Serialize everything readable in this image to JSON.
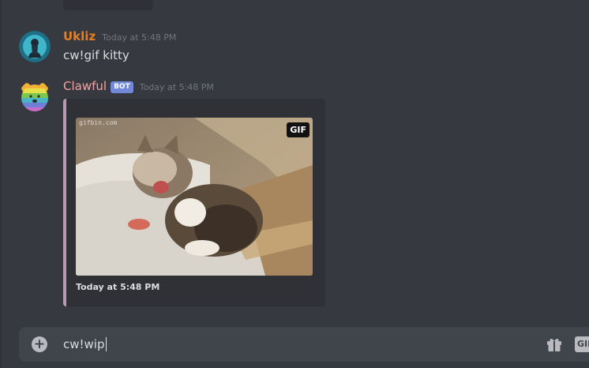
{
  "messages": [
    {
      "username": "Ukliz",
      "timestamp": "Today at 5:48 PM",
      "content": "cw!gif kitty",
      "avatar_icon": "user-avatar"
    },
    {
      "username": "Clawful",
      "bot_tag": "BOT",
      "timestamp": "Today at 5:48 PM",
      "avatar_icon": "rainbow-bear-avatar",
      "embed": {
        "accent_color": "#b89bb2",
        "image_badge": "GIF",
        "image_watermark": "gifbin.com",
        "footer": "Today at 5:48 PM"
      }
    }
  ],
  "composer": {
    "value": "cw!wip",
    "attach_icon": "plus-circle-icon",
    "gift_icon": "gift-icon",
    "gif_button_label": "GIF"
  },
  "colors": {
    "background": "#36393f",
    "embed_background": "#2f3136",
    "composer_background": "#40444b",
    "username_ukliz": "#e67e22",
    "username_clawful": "#f5a3a3",
    "bot_tag": "#7289da"
  }
}
